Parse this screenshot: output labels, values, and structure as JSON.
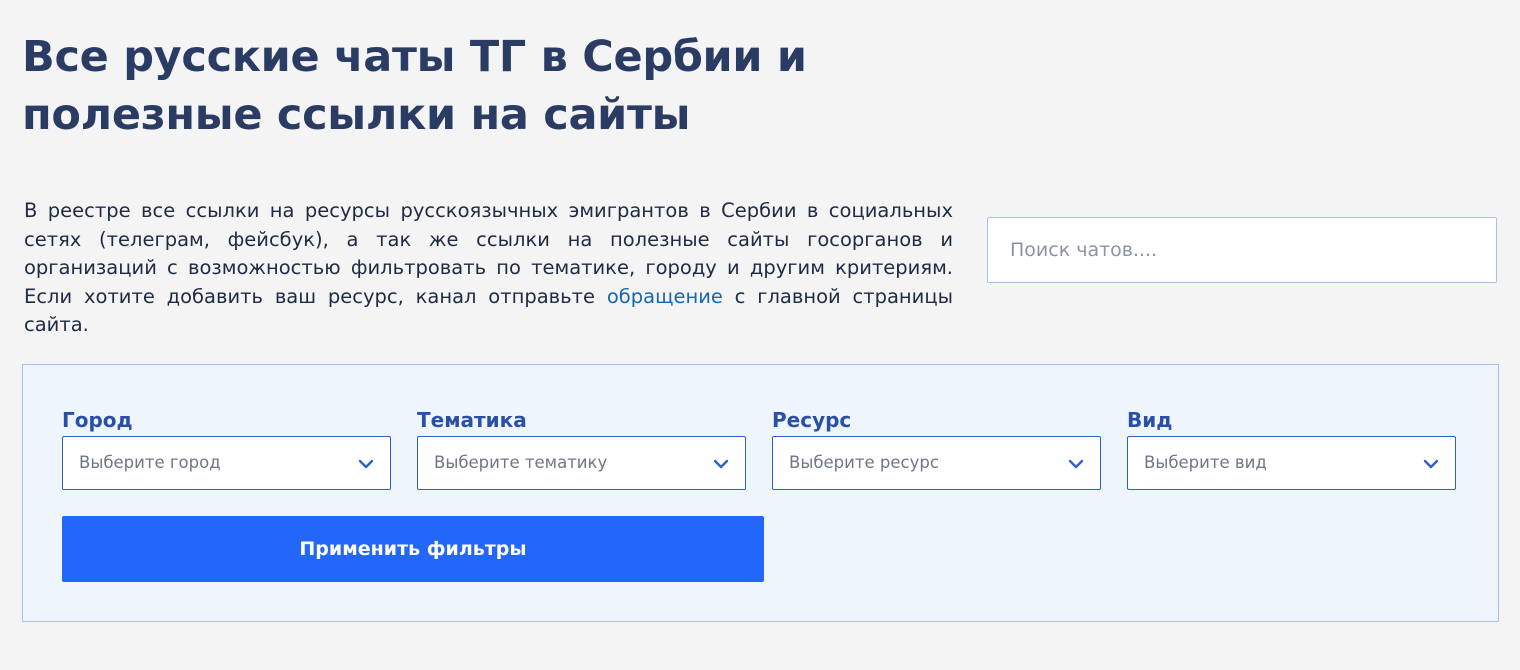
{
  "header": {
    "title_line1": "Все русские чаты ТГ в Сербии и",
    "title_line2": "полезные ссылки на сайты"
  },
  "intro": {
    "text_before_link": "В реестре все ссылки на ресурсы русскоязычных эмигрантов в Сербии в социальных сетях (телеграм, фейсбук), а так же ссылки на полезные сайты госорганов и организаций с возможностью фильтровать по тематике, городу и другим критериям. Если хотите добавить ваш ресурс, канал отправьте ",
    "link_text": "обращение",
    "text_after_link": " с главной страницы сайта."
  },
  "search": {
    "value": "",
    "placeholder": "Поиск чатов...."
  },
  "filters": [
    {
      "label": "Город",
      "placeholder": "Выберите город"
    },
    {
      "label": "Тематика",
      "placeholder": "Выберите тематику"
    },
    {
      "label": "Ресурс",
      "placeholder": "Выберите ресурс"
    },
    {
      "label": "Вид",
      "placeholder": "Выберите вид"
    }
  ],
  "apply_button": {
    "label": "Применить фильтры"
  },
  "icons": {
    "dropdown": "chevron-down-icon"
  },
  "colors": {
    "title": "#2b3c64",
    "link": "#1667b2",
    "filter_label": "#2a4fa6",
    "button_bg": "#2366fa",
    "panel_bg": "#eff5fd",
    "border": "#a9c1ea"
  }
}
